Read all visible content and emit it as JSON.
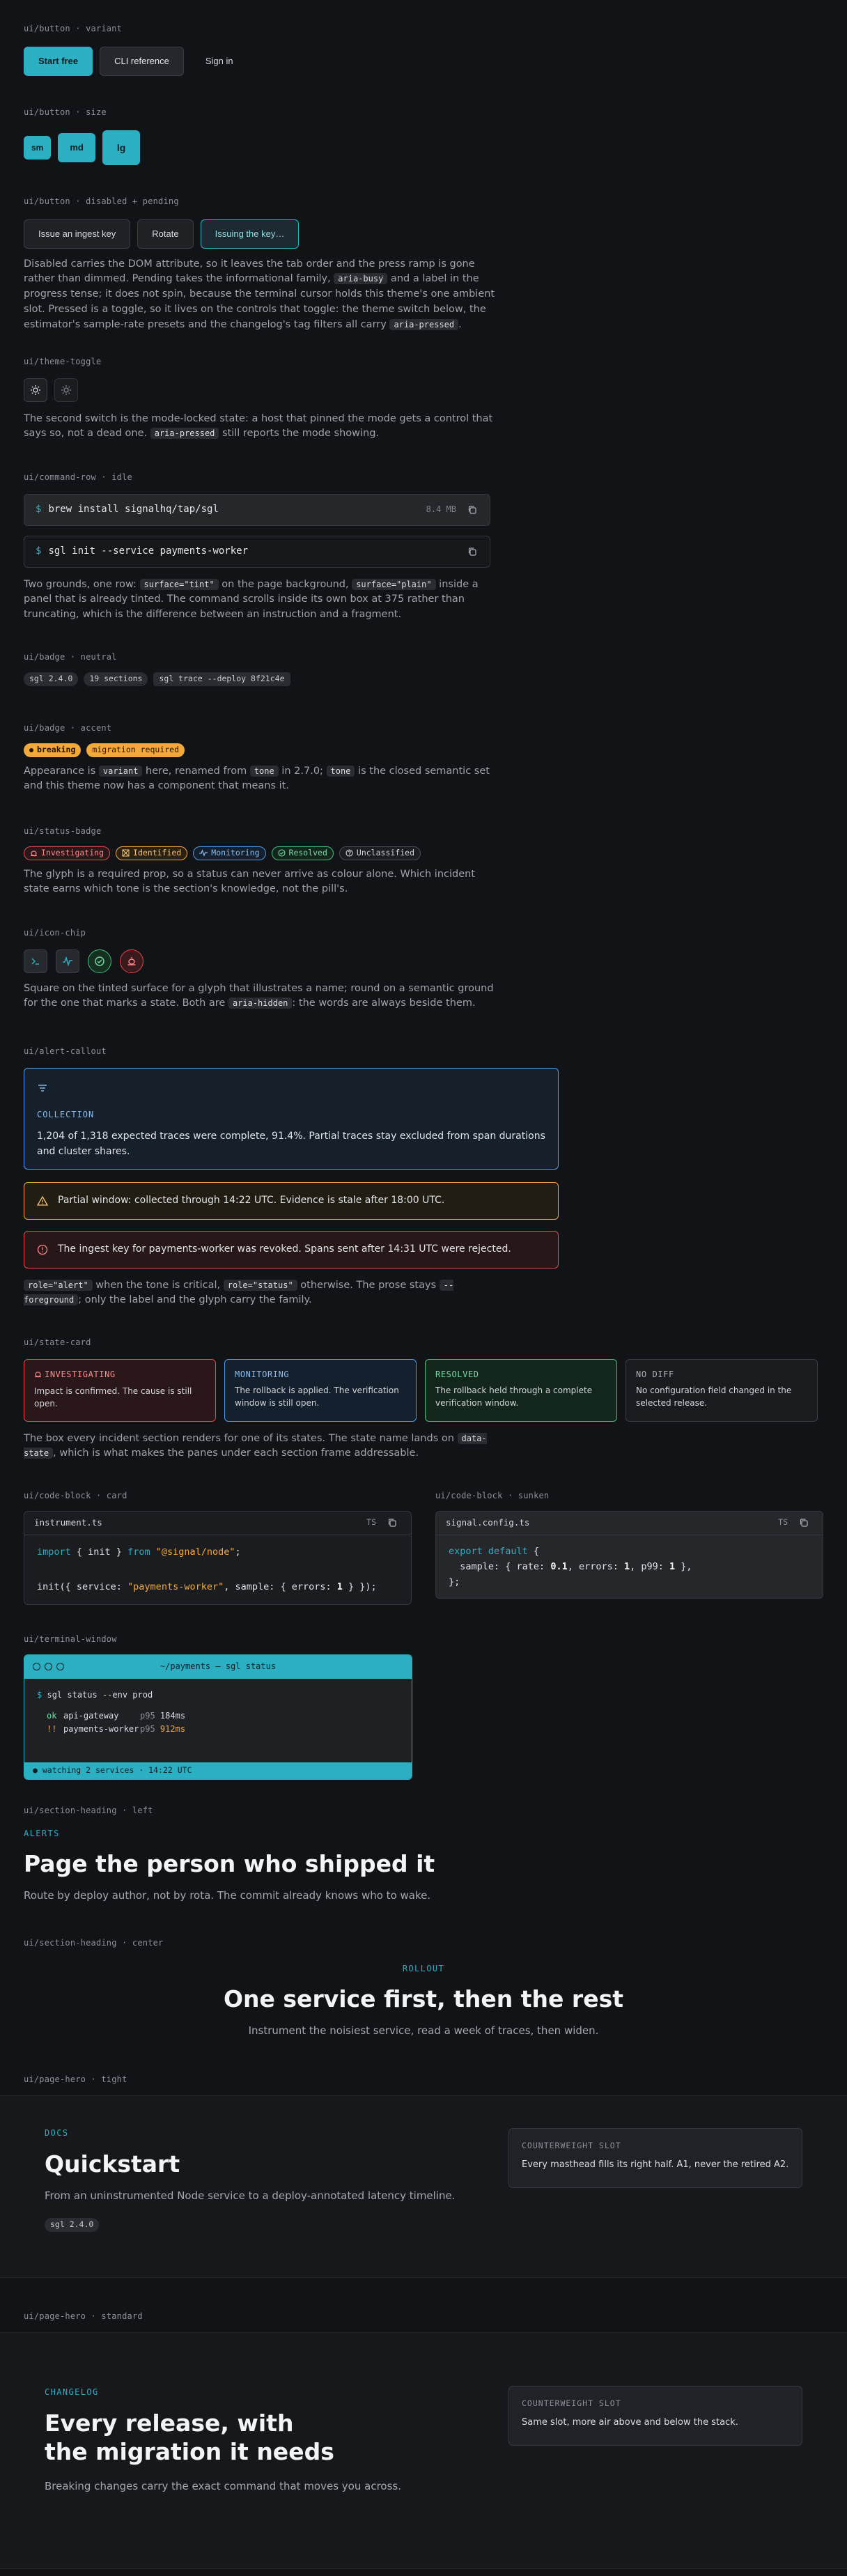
{
  "button_variant": {
    "label": "ui/button · variant",
    "start_free": "Start free",
    "cli_reference": "CLI reference",
    "sign_in": "Sign in"
  },
  "button_size": {
    "label": "ui/button · size",
    "sm": "sm",
    "md": "md",
    "lg": "lg"
  },
  "button_disabled": {
    "label": "ui/button · disabled + pending",
    "issue_key": "Issue an ingest key",
    "rotate": "Rotate",
    "issuing": "Issuing the key…",
    "prose": [
      "Disabled carries the DOM attribute, so it leaves the tab order and the press ramp is gone rather than dimmed. Pending takes the informational family, ",
      "aria-busy",
      " and a label in the progress tense; it does not spin, because the terminal cursor holds this theme's one ambient slot. Pressed is a toggle, so it lives on the controls that toggle: the theme switch below, the estimator's sample-rate presets and the changelog's tag filters all carry ",
      "aria-pressed",
      "."
    ]
  },
  "theme_toggle": {
    "label": "ui/theme-toggle",
    "prose": [
      "The second switch is the mode-locked state: a host that pinned the mode gets a control that says so, not a dead one. ",
      "aria-pressed",
      " still reports the mode showing."
    ]
  },
  "command_row": {
    "label": "ui/command-row · idle",
    "cmd1": "brew install signalhq/tap/sgl",
    "cmd1_size": "8.4 MB",
    "cmd2": "sgl init --service payments-worker",
    "dollar": "$",
    "prose": [
      "Two grounds, one row: ",
      "surface=\"tint\"",
      " on the page background, ",
      "surface=\"plain\"",
      " inside a panel that is already tinted. The command scrolls inside its own box at 375 rather than truncating, which is the difference between an instruction and a fragment."
    ]
  },
  "badge_neutral": {
    "label": "ui/badge · neutral",
    "items": [
      "sgl 2.4.0",
      "19 sections",
      "sgl trace --deploy 8f21c4e"
    ]
  },
  "badge_accent": {
    "label": "ui/badge · accent",
    "breaking": "breaking",
    "migration": "migration required",
    "prose": [
      "Appearance is ",
      "variant",
      " here, renamed from ",
      "tone",
      " in 2.7.0; ",
      "tone",
      " is the closed semantic set and this theme now has a component that means it."
    ]
  },
  "status_badge": {
    "label": "ui/status-badge",
    "items": [
      "Investigating",
      "Identified",
      "Monitoring",
      "Resolved",
      "Unclassified"
    ],
    "prose": "The glyph is a required prop, so a status can never arrive as colour alone. Which incident state earns which tone is the section's knowledge, not the pill's."
  },
  "icon_chip": {
    "label": "ui/icon-chip",
    "prose": [
      "Square on the tinted surface for a glyph that illustrates a name; round on a semantic ground for the one that marks a state. Both are ",
      "aria-hidden",
      ": the words are always beside them."
    ]
  },
  "alert_callout": {
    "label": "ui/alert-callout",
    "info_title": "COLLECTION",
    "info_body": "1,204 of 1,318 expected traces were complete, 91.4%. Partial traces stay excluded from span durations and cluster shares.",
    "warn_body": "Partial window: collected through 14:22 UTC. Evidence is stale after 18:00 UTC.",
    "crit_body": "The ingest key for payments-worker was revoked. Spans sent after 14:31 UTC were rejected.",
    "prose": [
      "role=\"alert\"",
      " when the tone is critical, ",
      "role=\"status\"",
      " otherwise. The prose stays ",
      "--foreground",
      "; only the label and the glyph carry the family."
    ]
  },
  "state_card": {
    "label": "ui/state-card",
    "cards": [
      {
        "title": "INVESTIGATING",
        "body": "Impact is confirmed. The cause is still open."
      },
      {
        "title": "MONITORING",
        "body": "The rollback is applied. The verification window is still open."
      },
      {
        "title": "RESOLVED",
        "body": "The rollback held through a complete verification window."
      },
      {
        "title": "NO DIFF",
        "body": "No configuration field changed in the selected release."
      }
    ],
    "prose": [
      "The box every incident section renders for one of its states. The state name lands on ",
      "data-state",
      ", which is what makes the panes under each section frame addressable."
    ]
  },
  "code_card": {
    "label": "ui/code-block · card",
    "filename": "instrument.ts",
    "lang": "TS"
  },
  "code_sunken": {
    "label": "ui/code-block · sunken",
    "filename": "signal.config.ts",
    "lang": "TS"
  },
  "terminal": {
    "label": "ui/terminal-window",
    "title": "~/payments — sgl status",
    "prompt": "$",
    "command": "sgl status --env prod",
    "rows": [
      {
        "mark": "ok",
        "service": "api-gateway",
        "metric": "p95",
        "value": "184ms"
      },
      {
        "mark": "!!",
        "service": "payments-worker",
        "metric": "p95",
        "value": "912ms"
      }
    ],
    "footer": "● watching 2 services · 14:22 UTC"
  },
  "heading_left": {
    "label": "ui/section-heading · left",
    "eyebrow": "ALERTS",
    "title": "Page the person who shipped it",
    "lead": "Route by deploy author, not by rota. The commit already knows who to wake."
  },
  "heading_center": {
    "label": "ui/section-heading · center",
    "eyebrow": "ROLLOUT",
    "title": "One service first, then the rest",
    "lead": "Instrument the noisiest service, read a week of traces, then widen."
  },
  "hero_tight": {
    "label": "ui/page-hero · tight",
    "eyebrow": "DOCS",
    "title": "Quickstart",
    "lead": "From an uninstrumented Node service to a deploy-annotated latency timeline.",
    "badge": "sgl 2.4.0",
    "slot_title": "COUNTERWEIGHT SLOT",
    "slot_body": "Every masthead fills its right half. A1, never the retired A2."
  },
  "hero_standard": {
    "label": "ui/page-hero · standard",
    "eyebrow": "CHANGELOG",
    "title_line1": "Every release, with",
    "title_line2": "the migration it needs",
    "lead": "Breaking changes carry the exact command that moves you across.",
    "slot_title": "COUNTERWEIGHT SLOT",
    "slot_body": "Same slot, more air above and below the stack."
  },
  "colors": {
    "accent": "#2bb0c3",
    "amber": "#f2a93b",
    "critical": "#e5484d",
    "success": "#3fbf7f",
    "info": "#4e9be6",
    "background": "#121316"
  }
}
